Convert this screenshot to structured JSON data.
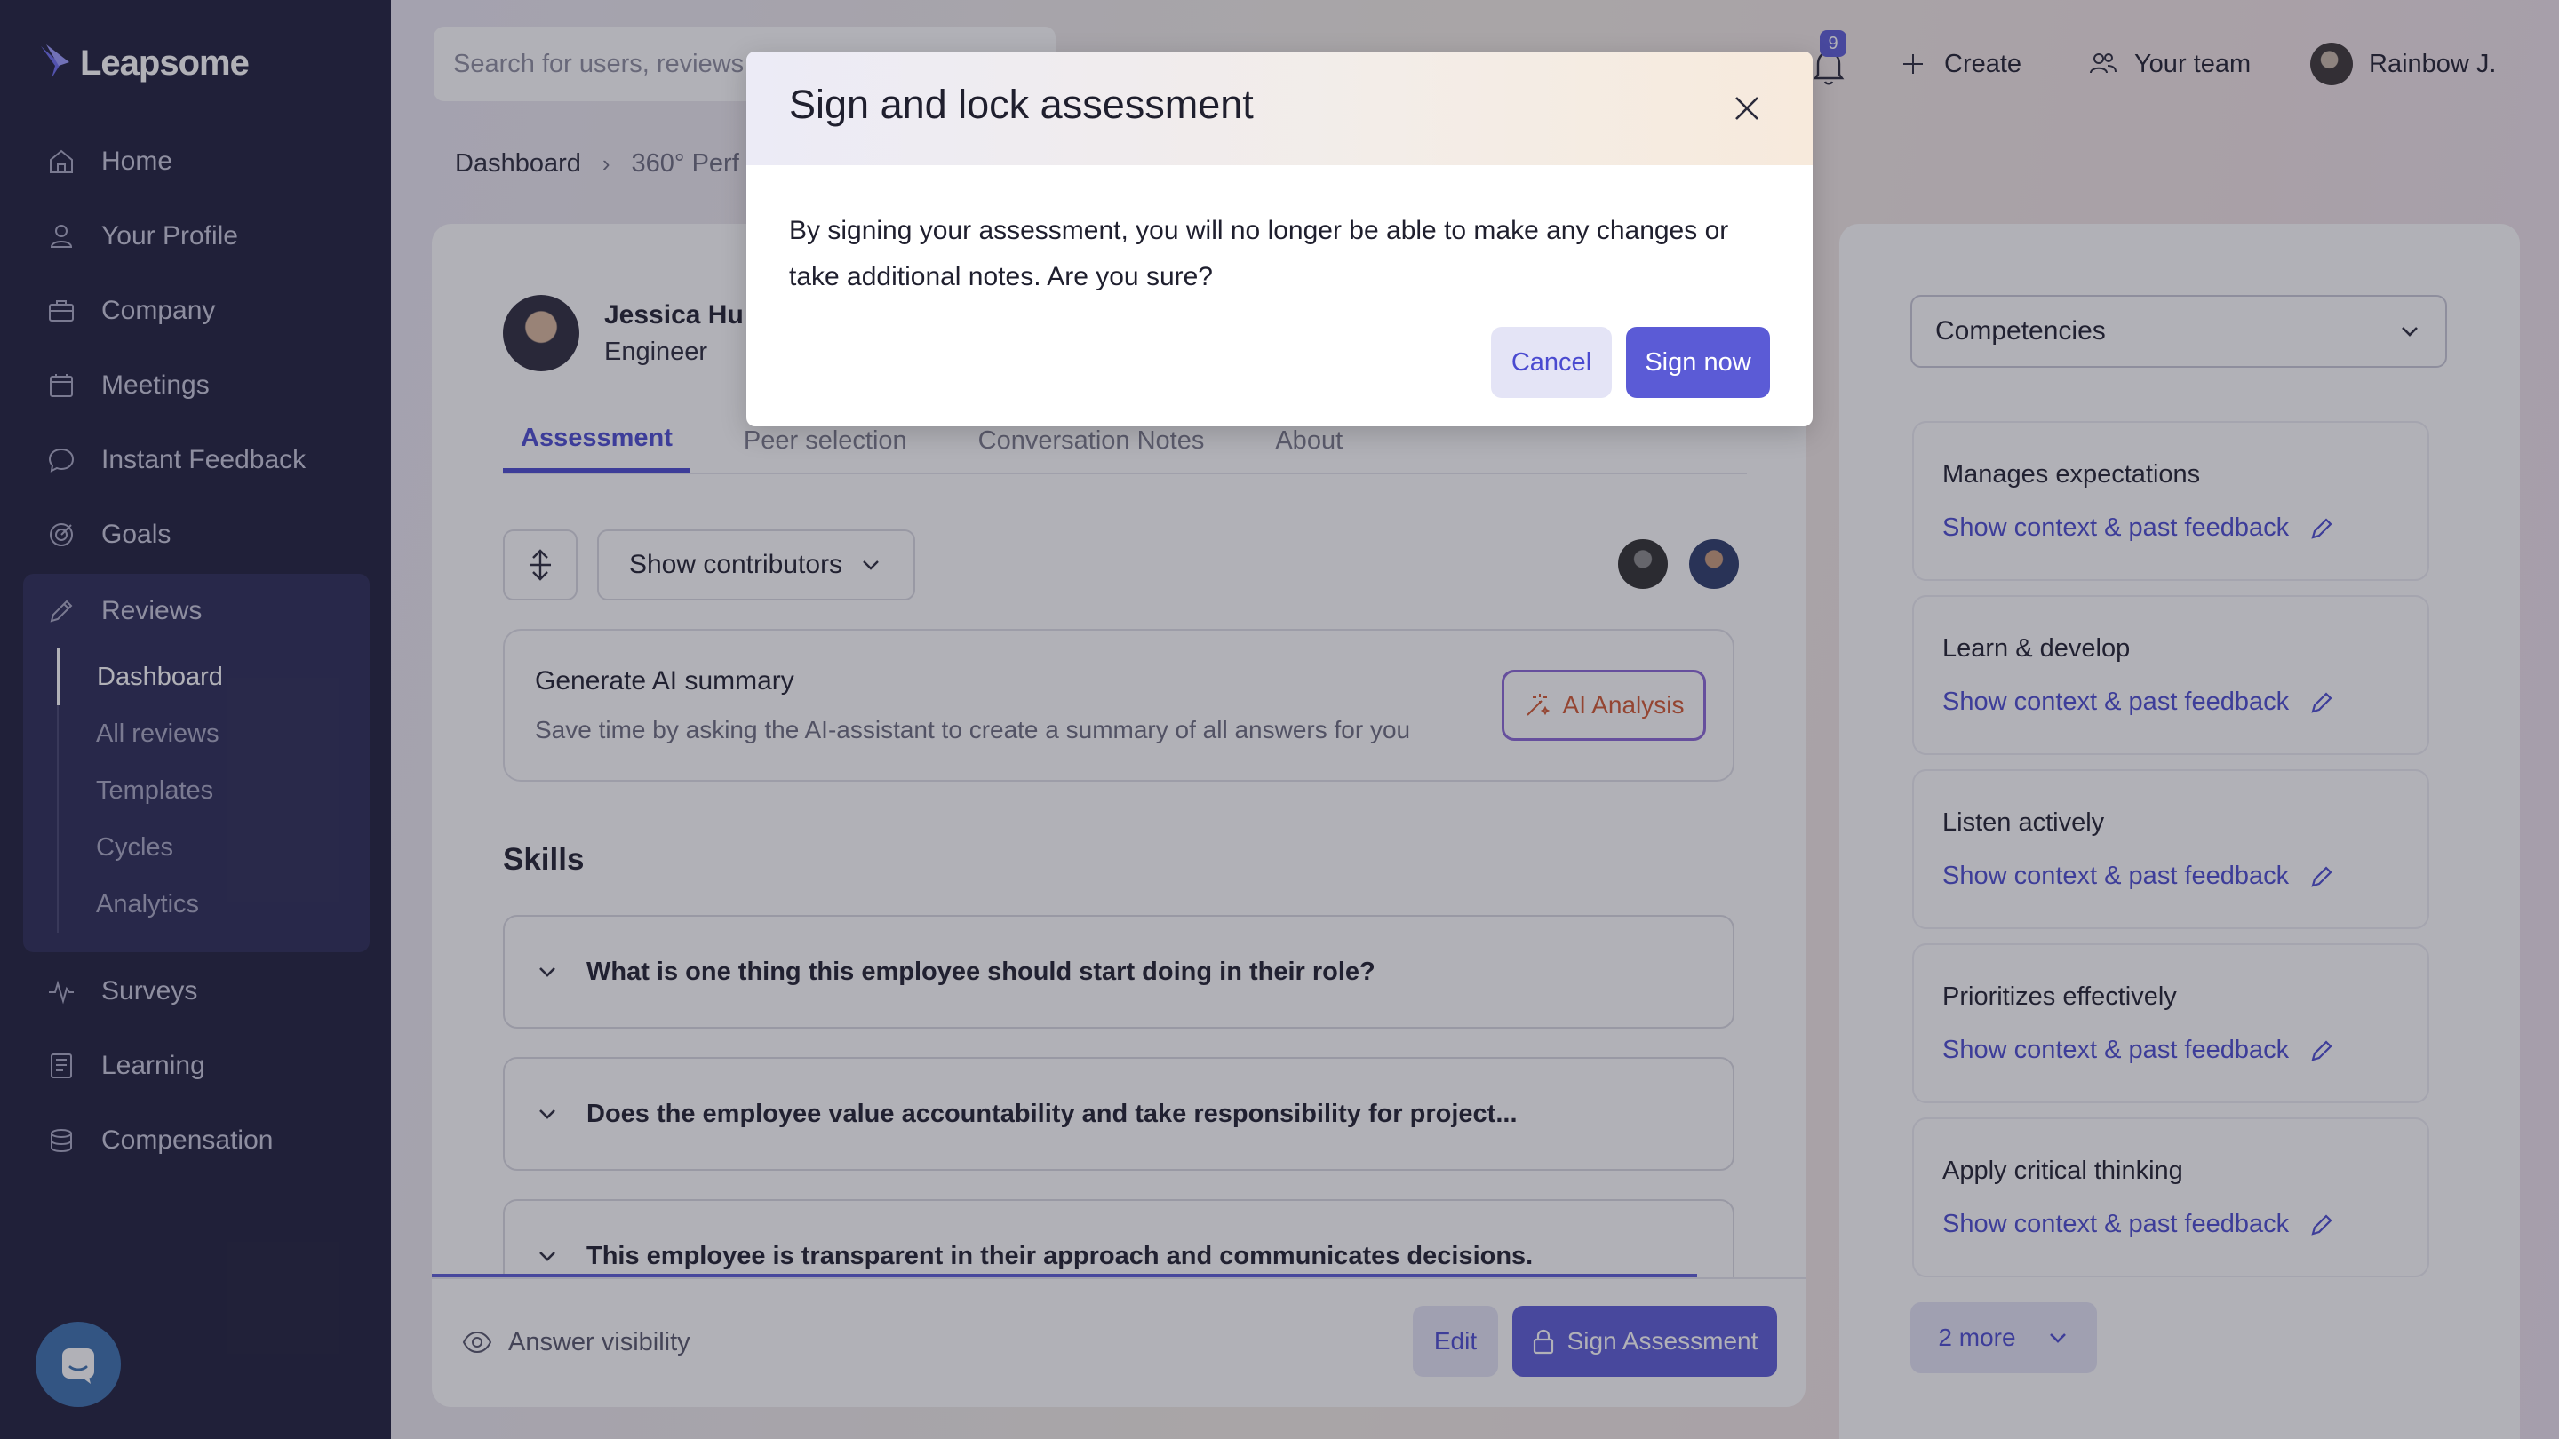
{
  "app": {
    "name": "Leapsome"
  },
  "sidebar": {
    "items": [
      {
        "label": "Home",
        "icon": "home-icon"
      },
      {
        "label": "Your Profile",
        "icon": "user-icon"
      },
      {
        "label": "Company",
        "icon": "briefcase-icon"
      },
      {
        "label": "Meetings",
        "icon": "calendar-icon"
      },
      {
        "label": "Instant Feedback",
        "icon": "chat-icon"
      },
      {
        "label": "Goals",
        "icon": "target-icon"
      },
      {
        "label": "Reviews",
        "icon": "pencil-icon"
      },
      {
        "label": "Surveys",
        "icon": "pulse-icon"
      },
      {
        "label": "Learning",
        "icon": "book-icon"
      },
      {
        "label": "Compensation",
        "icon": "coins-icon"
      }
    ],
    "reviews_sub": [
      "Dashboard",
      "All reviews",
      "Templates",
      "Cycles",
      "Analytics"
    ],
    "active_sub": "Dashboard"
  },
  "topbar": {
    "search_placeholder": "Search for users, reviews",
    "notification_count": "9",
    "create_label": "Create",
    "team_label": "Your team",
    "user_name": "Rainbow J."
  },
  "breadcrumb": {
    "root": "Dashboard",
    "current": "360° Perf"
  },
  "employee": {
    "name": "Jessica Hu",
    "role": "Engineer"
  },
  "tabs": [
    "Assessment",
    "Peer selection",
    "Conversation Notes",
    "About"
  ],
  "active_tab": "Assessment",
  "toolbar": {
    "contributors_label": "Show contributors"
  },
  "ai_card": {
    "title": "Generate AI summary",
    "subtitle": "Save time by asking the AI-assistant to create a summary of all answers for you",
    "button": "AI Analysis"
  },
  "skills": {
    "title": "Skills",
    "questions": [
      "What is one thing this employee should start doing in their role?",
      "Does the employee value accountability and take responsibility for project...",
      "This employee is transparent in their approach and communicates decisions."
    ]
  },
  "footer": {
    "visibility_label": "Answer visibility",
    "edit_label": "Edit",
    "sign_label": "Sign Assessment"
  },
  "right_panel": {
    "select_value": "Competencies",
    "link_label": "Show context & past feedback",
    "competencies": [
      "Manages expectations",
      "Learn & develop",
      "Listen actively",
      "Prioritizes effectively",
      "Apply critical thinking"
    ],
    "more_label": "2 more"
  },
  "modal": {
    "title": "Sign and lock assessment",
    "body": "By signing your assessment, you will no longer be able to make any changes or take additional notes. Are you sure?",
    "cancel": "Cancel",
    "confirm": "Sign now"
  },
  "colors": {
    "sidebar_bg": "#1d1d3a",
    "accent": "#5b5bd6",
    "ai_button_text": "#d2562f"
  }
}
